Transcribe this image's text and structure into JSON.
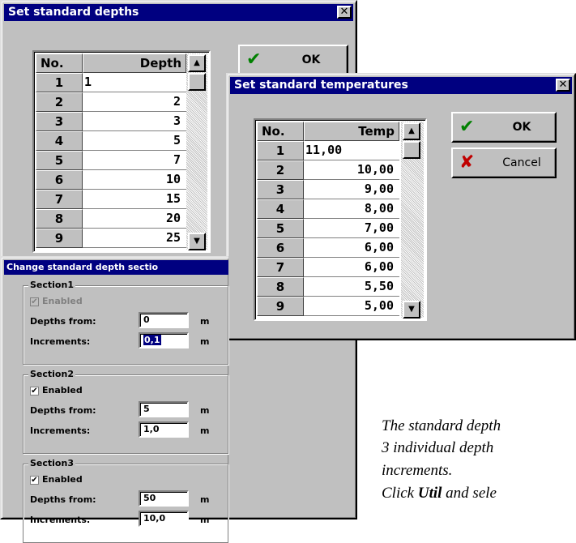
{
  "depths": {
    "title": "Set standard depths",
    "col_no": "No.",
    "col_val": "Depth",
    "ok": "OK",
    "rows": [
      {
        "n": "1",
        "v": "1"
      },
      {
        "n": "2",
        "v": "2"
      },
      {
        "n": "3",
        "v": "3"
      },
      {
        "n": "4",
        "v": "5"
      },
      {
        "n": "5",
        "v": "7"
      },
      {
        "n": "6",
        "v": "10"
      },
      {
        "n": "7",
        "v": "15"
      },
      {
        "n": "8",
        "v": "20"
      },
      {
        "n": "9",
        "v": "25"
      }
    ]
  },
  "temps": {
    "title": "Set standard temperatures",
    "col_no": "No.",
    "col_val": "Temp",
    "ok": "OK",
    "cancel": "Cancel",
    "rows": [
      {
        "n": "1",
        "v": "11,00"
      },
      {
        "n": "2",
        "v": "10,00"
      },
      {
        "n": "3",
        "v": "9,00"
      },
      {
        "n": "4",
        "v": "8,00"
      },
      {
        "n": "5",
        "v": "7,00"
      },
      {
        "n": "6",
        "v": "6,00"
      },
      {
        "n": "7",
        "v": "6,00"
      },
      {
        "n": "8",
        "v": "5,50"
      },
      {
        "n": "9",
        "v": "5,00"
      }
    ]
  },
  "sections": {
    "title": "Change standard depth sectio",
    "enabled": "Enabled",
    "depths_from": "Depths from:",
    "increments": "Increments:",
    "unit": "m",
    "items": [
      {
        "name": "Section1",
        "from": "0",
        "inc": "0,1",
        "checked": "✔"
      },
      {
        "name": "Section2",
        "from": "5",
        "inc": "1,0",
        "checked": "✔"
      },
      {
        "name": "Section3",
        "from": "50",
        "inc": "10,0",
        "checked": "✔"
      }
    ]
  },
  "caption": {
    "line1": "The standard depth",
    "line2": "3 individual depth",
    "line3": "increments.",
    "line4_pre": "Click ",
    "line4_bold": "Util",
    "line4_post": " and sele"
  },
  "icons": {
    "close": "✕",
    "check": "✔",
    "cross": "✘",
    "up": "▲",
    "down": "▼"
  }
}
